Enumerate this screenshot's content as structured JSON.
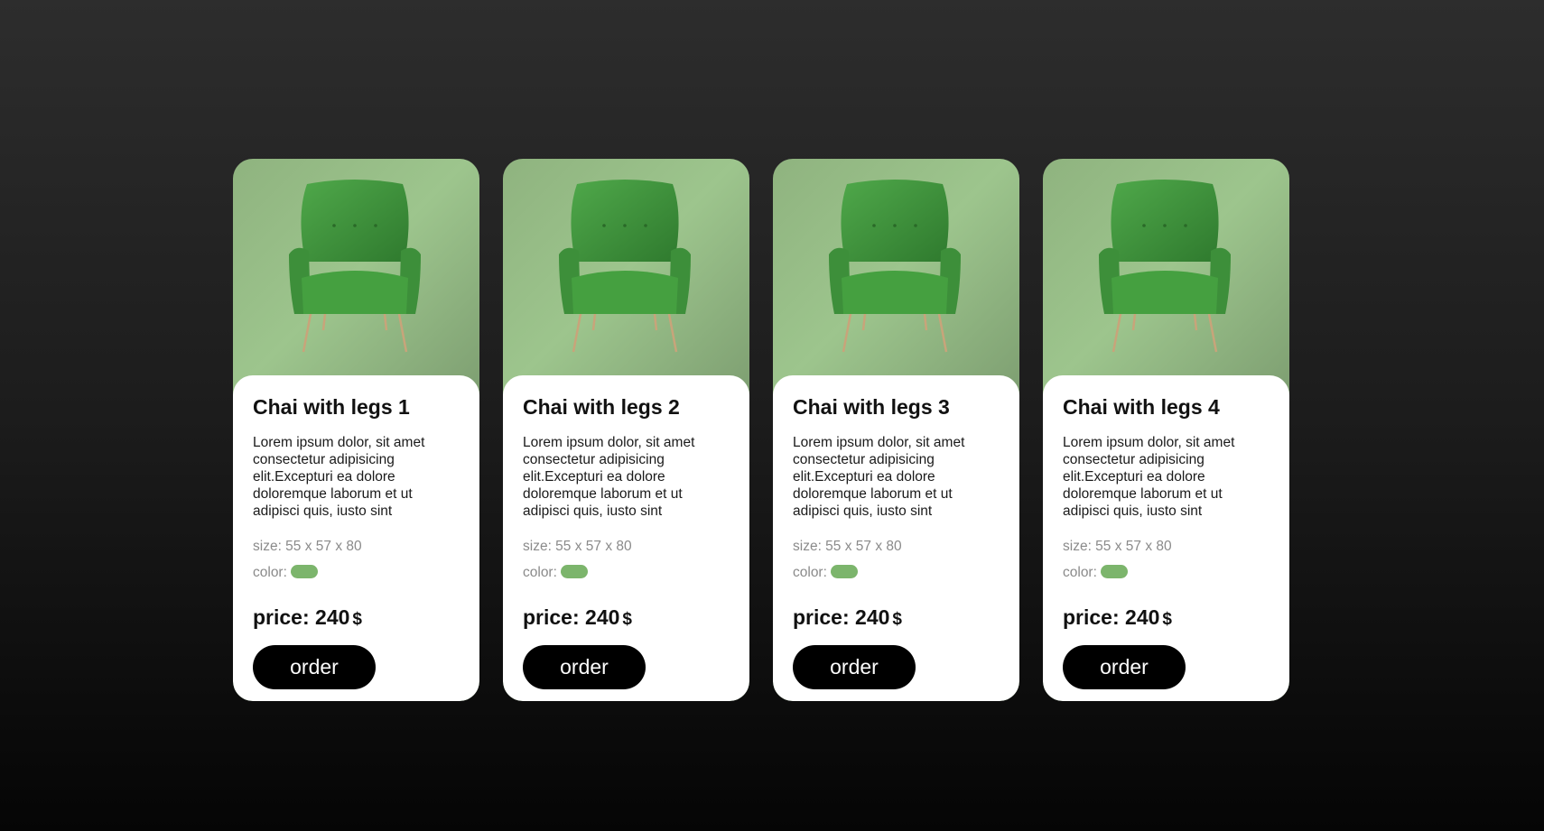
{
  "colors": {
    "accent_green": "#7cb56c",
    "button_bg": "#000000",
    "card_bg": "#ffffff"
  },
  "cards": [
    {
      "image": "green-armchair-image",
      "title": "Chai with legs 1",
      "description": "Lorem ipsum dolor, sit amet consectetur adipisicing elit.Excepturi ea dolore doloremque laborum et ut adipisci quis, iusto sint",
      "size_label": "size: 55 x 57 x 80",
      "color_label": "color:",
      "color_value": "#7cb56c",
      "price_label": "price: 240",
      "currency": "$",
      "order_label": "order"
    },
    {
      "image": "green-armchair-image",
      "title": "Chai with legs 2",
      "description": "Lorem ipsum dolor, sit amet consectetur adipisicing elit.Excepturi ea dolore doloremque laborum et ut adipisci quis, iusto sint",
      "size_label": "size: 55 x 57 x 80",
      "color_label": "color:",
      "color_value": "#7cb56c",
      "price_label": "price: 240",
      "currency": "$",
      "order_label": "order"
    },
    {
      "image": "green-armchair-image",
      "title": "Chai with legs 3",
      "description": "Lorem ipsum dolor, sit amet consectetur adipisicing elit.Excepturi ea dolore doloremque laborum et ut adipisci quis, iusto sint",
      "size_label": "size: 55 x 57 x 80",
      "color_label": "color:",
      "color_value": "#7cb56c",
      "price_label": "price: 240",
      "currency": "$",
      "order_label": "order"
    },
    {
      "image": "green-armchair-image",
      "title": "Chai with legs 4",
      "description": "Lorem ipsum dolor, sit amet consectetur adipisicing elit.Excepturi ea dolore doloremque laborum et ut adipisci quis, iusto sint",
      "size_label": "size: 55 x 57 x 80",
      "color_label": "color:",
      "color_value": "#7cb56c",
      "price_label": "price: 240",
      "currency": "$",
      "order_label": "order"
    }
  ]
}
